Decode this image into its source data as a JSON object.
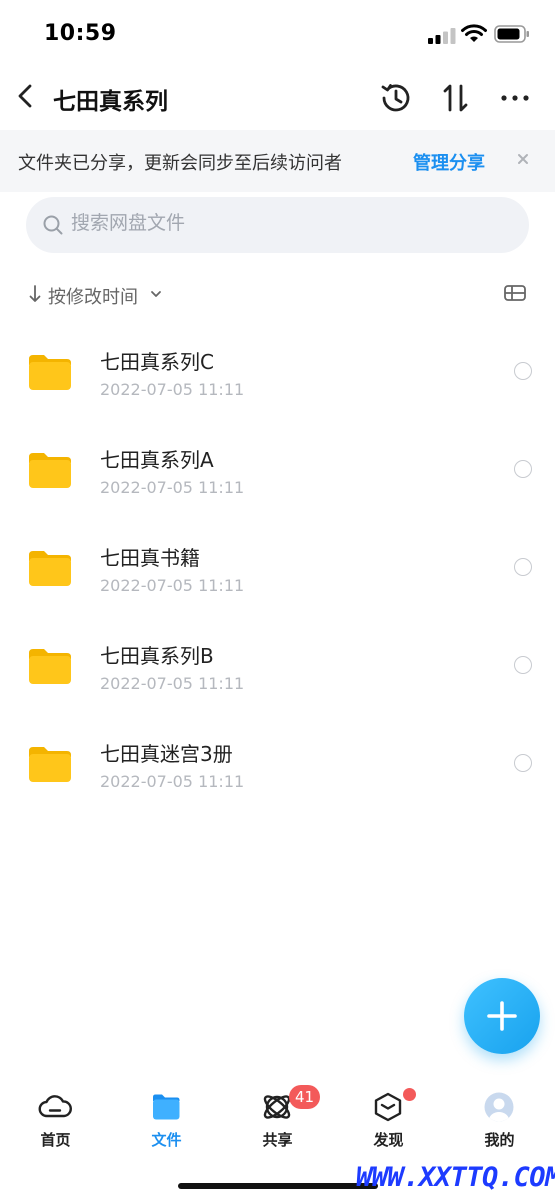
{
  "status_bar": {
    "time": "10:59"
  },
  "header": {
    "title": "七田真系列"
  },
  "share_banner": {
    "text": "文件夹已分享，更新会同步至后续访问者",
    "manage_label": "管理分享"
  },
  "search": {
    "placeholder": "搜索网盘文件"
  },
  "sort": {
    "label": "按修改时间"
  },
  "files": [
    {
      "name": "七田真系列C",
      "date": "2022-07-05 11:11"
    },
    {
      "name": "七田真系列A",
      "date": "2022-07-05 11:11"
    },
    {
      "name": "七田真书籍",
      "date": "2022-07-05 11:11"
    },
    {
      "name": "七田真系列B",
      "date": "2022-07-05 11:11"
    },
    {
      "name": "七田真迷宫3册",
      "date": "2022-07-05 11:11"
    }
  ],
  "tabs": [
    {
      "label": "首页",
      "icon": "cloud-icon"
    },
    {
      "label": "文件",
      "icon": "folder-icon",
      "active": true
    },
    {
      "label": "共享",
      "icon": "share-orbit-icon",
      "badge": "41"
    },
    {
      "label": "发现",
      "icon": "box-icon"
    },
    {
      "label": "我的",
      "icon": "avatar-icon"
    }
  ],
  "colors": {
    "accent": "#1b8ff0",
    "badge": "#f35a5a",
    "folder": "#ffc61a"
  },
  "watermark": "WWW.XXTTQ.COM"
}
